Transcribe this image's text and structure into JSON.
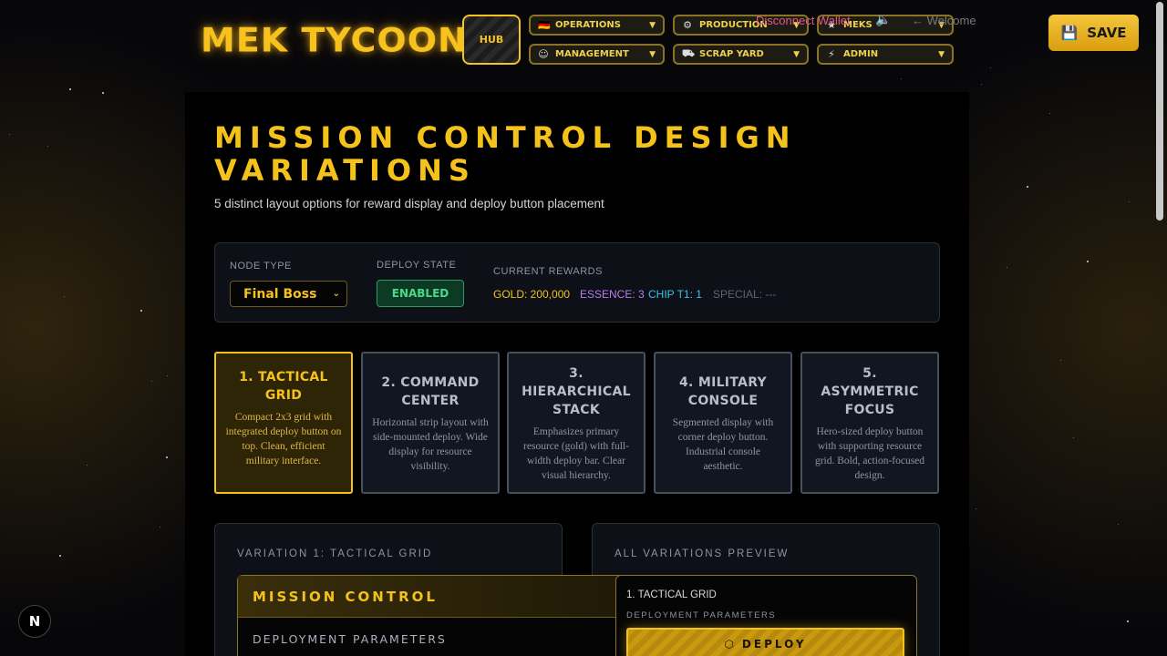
{
  "header": {
    "logo": "MEK TYCOON",
    "hub_label": "HUB",
    "nav": [
      {
        "label": "OPERATIONS",
        "icon": "🇩🇪"
      },
      {
        "label": "PRODUCTION",
        "icon": "⚙"
      },
      {
        "label": "MEKS",
        "icon": "★"
      },
      {
        "label": "MANAGEMENT",
        "icon": "☺"
      },
      {
        "label": "SCRAP YARD",
        "icon": "⛟"
      },
      {
        "label": "ADMIN",
        "icon": "⚡"
      }
    ],
    "caret": "▼",
    "disconnect": "Disconnect Wallet",
    "volume_icon": "🔈",
    "welcome": "← Welcome",
    "save_label": "SAVE",
    "save_icon": "💾"
  },
  "page": {
    "title": "MISSION CONTROL DESIGN VARIATIONS",
    "subtitle": "5 distinct layout options for reward display and deploy button placement"
  },
  "controls": {
    "node_type_label": "NODE TYPE",
    "node_type_value": "Final Boss",
    "deploy_state_label": "DEPLOY STATE",
    "deploy_state_value": "ENABLED",
    "current_rewards_label": "CURRENT REWARDS",
    "rewards": {
      "gold": "GOLD: 200,000",
      "essence": "ESSENCE: 3",
      "chip": "CHIP T1: 1",
      "special": "SPECIAL: ---"
    },
    "reward_colors": {
      "gold": "#f5c21c",
      "essence": "#b97cf0",
      "chip": "#37c3e6",
      "special": "#5d6372"
    }
  },
  "variations": [
    {
      "title": "1. TACTICAL GRID",
      "desc": "Compact 2x3 grid with integrated deploy button on top. Clean, efficient military interface.",
      "active": true
    },
    {
      "title": "2. COMMAND CENTER",
      "desc": "Horizontal strip layout with side-mounted deploy. Wide display for resource visibility.",
      "active": false
    },
    {
      "title": "3. HIERARCHICAL STACK",
      "desc": "Emphasizes primary resource (gold) with full-width deploy bar. Clear visual hierarchy.",
      "active": false
    },
    {
      "title": "4. MILITARY CONSOLE",
      "desc": "Segmented display with corner deploy button. Industrial console aesthetic.",
      "active": false
    },
    {
      "title": "5. ASYMMETRIC FOCUS",
      "desc": "Hero-sized deploy button with supporting resource grid. Bold, action-focused design.",
      "active": false
    }
  ],
  "detail": {
    "section_label": "VARIATION 1: TACTICAL GRID",
    "mission_title": "MISSION CONTROL",
    "mission_sub": "DEPLOYMENT PARAMETERS"
  },
  "preview": {
    "section_label": "ALL VARIATIONS PREVIEW",
    "item_title": "1. TACTICAL GRID",
    "item_sub": "DEPLOYMENT PARAMETERS",
    "deploy_label": "DEPLOY",
    "deploy_icon": "⬡"
  },
  "misc": {
    "next_badge": "N"
  },
  "colors": {
    "accent": "#f5c21c",
    "enabled_green": "#4ad889",
    "disconnect_pink": "#e05a86"
  }
}
